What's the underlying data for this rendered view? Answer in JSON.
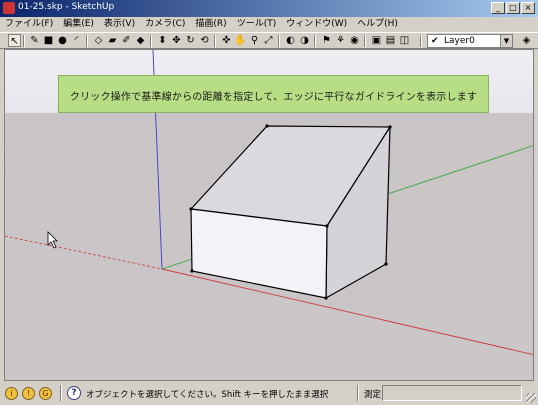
{
  "window": {
    "title": "01-25.skp - SketchUp"
  },
  "window_buttons": [
    "_",
    "□",
    "×"
  ],
  "menu": [
    "ファイル(F)",
    "編集(E)",
    "表示(V)",
    "カメラ(C)",
    "描画(R)",
    "ツール(T)",
    "ウィンドウ(W)",
    "ヘルプ(H)"
  ],
  "toolbar": {
    "tools": [
      {
        "name": "select",
        "glyph": "↖"
      },
      {
        "name": "pencil",
        "glyph": "✎"
      },
      {
        "name": "rectangle",
        "glyph": "■"
      },
      {
        "name": "circle",
        "glyph": "●"
      },
      {
        "name": "arc",
        "glyph": "◜"
      },
      {
        "name": "make-component",
        "glyph": "◇"
      },
      {
        "name": "eraser",
        "glyph": "▰"
      },
      {
        "name": "tape-measure",
        "glyph": "✐"
      },
      {
        "name": "paint-bucket",
        "glyph": "◆"
      },
      {
        "name": "push-pull",
        "glyph": "⬍"
      },
      {
        "name": "move",
        "glyph": "✥"
      },
      {
        "name": "rotate",
        "glyph": "↻"
      },
      {
        "name": "offset",
        "glyph": "⟲"
      },
      {
        "name": "orbit",
        "glyph": "✜"
      },
      {
        "name": "pan",
        "glyph": "✋"
      },
      {
        "name": "zoom",
        "glyph": "⚲"
      },
      {
        "name": "zoom-extents",
        "glyph": "⤢"
      },
      {
        "name": "previous-view",
        "glyph": "◐"
      },
      {
        "name": "next-view",
        "glyph": "◑"
      },
      {
        "name": "position-camera",
        "glyph": "⚑"
      },
      {
        "name": "walk",
        "glyph": "⚘"
      },
      {
        "name": "look-around",
        "glyph": "◉"
      },
      {
        "name": "section-plane",
        "glyph": "▣"
      },
      {
        "name": "components-window",
        "glyph": "▤"
      },
      {
        "name": "materials-window",
        "glyph": "◫"
      }
    ],
    "layer": "Layer0"
  },
  "viewport": {
    "tooltip": "クリック操作で基準線からの距離を指定して、エッジに平行なガイドラインを表示します"
  },
  "statusbar": {
    "icons": [
      "i",
      "!",
      "G"
    ],
    "help": "?",
    "text": "オブジェクトを選択してください。Shift キーを押したまま選択",
    "measure_label": "測定",
    "measure_value": ""
  },
  "colors": {
    "sky": "#e8e8ed",
    "ground": "#cbc7c8",
    "tooltip_bg": "#b7de84",
    "axis_red": "#cc3a3a",
    "axis_green": "#3aa53a",
    "axis_blue": "#3a3acc",
    "front_face": "#f4f2f6",
    "roof_face": "#dcd9de",
    "side_face": "#d6d3d8"
  }
}
